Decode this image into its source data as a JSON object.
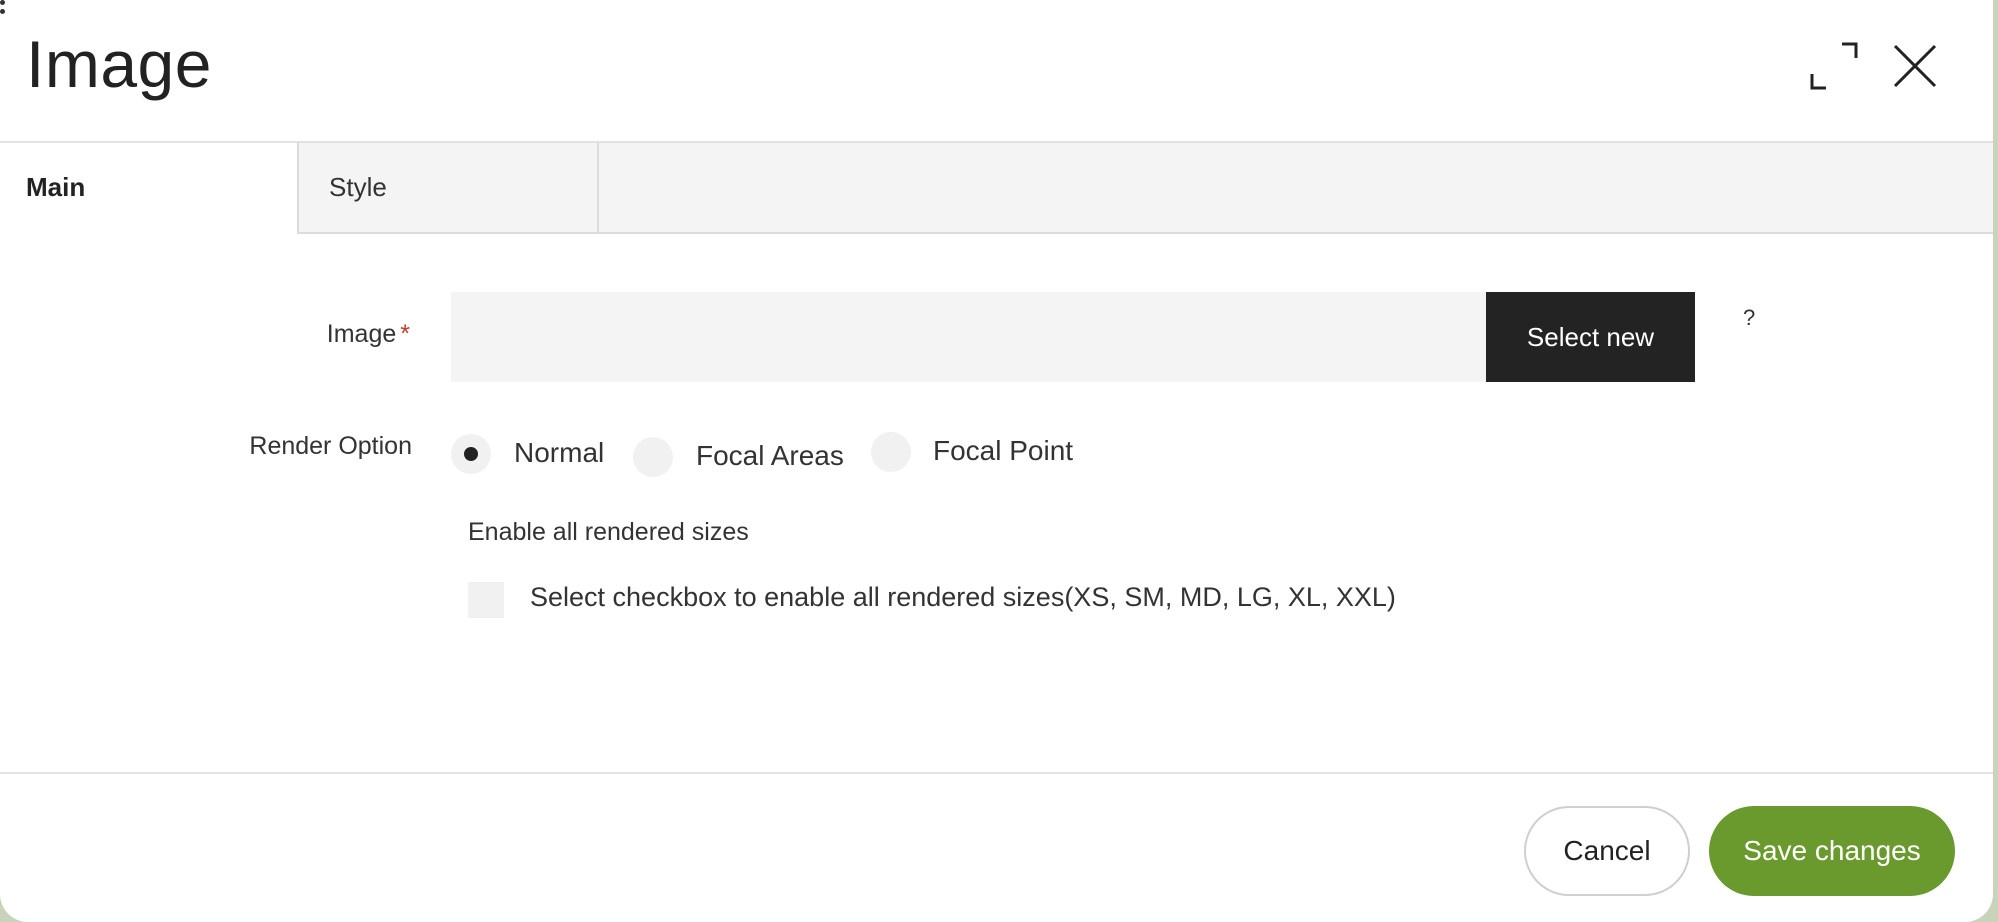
{
  "dialog": {
    "title": "Image"
  },
  "header": {
    "expand_icon": "expand-icon",
    "close_icon": "close-icon"
  },
  "tabs": [
    {
      "label": "Main",
      "active": true
    },
    {
      "label": "Style",
      "active": false
    }
  ],
  "form": {
    "image_label": "Image",
    "required_mark": "*",
    "image_value": "",
    "select_button": "Select new",
    "help": "?",
    "render_option_label": "Render Option",
    "render_options": [
      {
        "label": "Normal",
        "checked": true
      },
      {
        "label": "Focal Areas",
        "checked": false
      },
      {
        "label": "Focal Point",
        "checked": false
      }
    ],
    "enable_sizes_label": "Enable all rendered sizes",
    "enable_sizes_checkbox_label": "Select checkbox to enable all rendered sizes(XS, SM, MD, LG, XL, XXL)",
    "enable_sizes_checked": false
  },
  "footer": {
    "cancel": "Cancel",
    "save": "Save changes"
  },
  "colors": {
    "accent": "#6a9a2e",
    "dark_button": "#232323",
    "required": "#c0392b"
  }
}
